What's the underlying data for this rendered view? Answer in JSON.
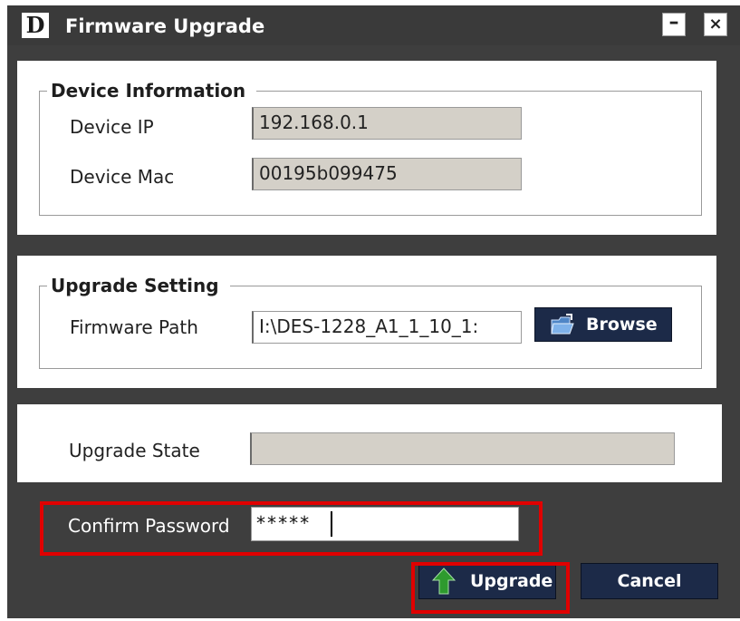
{
  "window": {
    "title": "Firmware Upgrade",
    "logo_text": "D",
    "minimize_glyph": "–",
    "close_glyph": "×"
  },
  "device_info": {
    "heading": "Device Information",
    "ip_label": "Device IP",
    "ip_value": "192.168.0.1",
    "mac_label": "Device Mac",
    "mac_value": "00195b099475"
  },
  "upgrade_setting": {
    "heading": "Upgrade Setting",
    "path_label": "Firmware Path",
    "path_value": "I:\\DES-1228_A1_1_10_1:",
    "browse_label": "Browse",
    "browse_icon": "folder-icon"
  },
  "upgrade_state": {
    "label": "Upgrade State",
    "value": ""
  },
  "password": {
    "label": "Confirm Password",
    "value": "*****"
  },
  "buttons": {
    "upgrade_label": "Upgrade",
    "upgrade_icon": "up-arrow-icon",
    "cancel_label": "Cancel"
  },
  "colors": {
    "window_bg": "#3e3e3e",
    "button_bg": "#1c2a48",
    "highlight": "#e00000",
    "arrow_green": "#2e9a2e"
  }
}
